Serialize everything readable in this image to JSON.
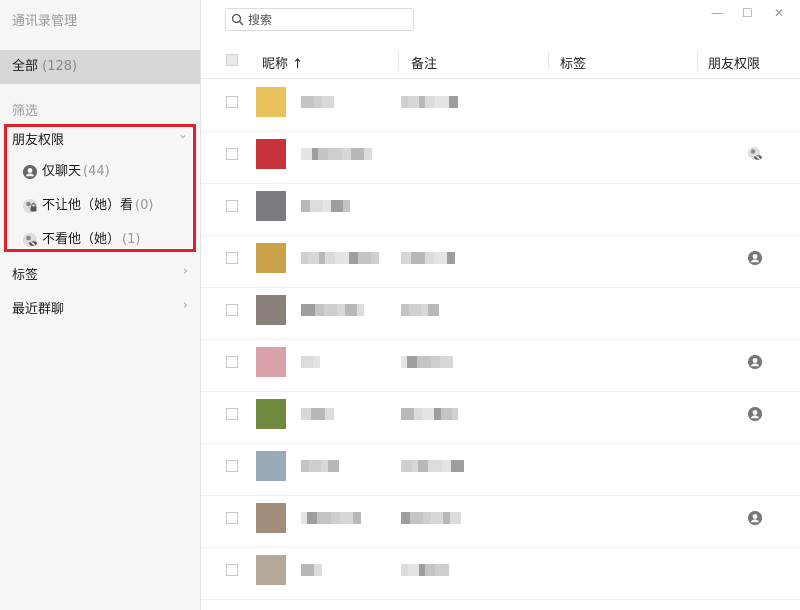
{
  "sidebar": {
    "title": "通讯录管理",
    "all_label": "全部",
    "all_count": "(128)",
    "filter_label": "筛选",
    "permission_label": "朋友权限",
    "permission_items": [
      {
        "label": "仅聊天",
        "count": "(44)",
        "icon": "person-icon"
      },
      {
        "label": "不让他（她）看",
        "count": "(0)",
        "icon": "lock-icon"
      },
      {
        "label": "不看他（她）",
        "count": "(1)",
        "icon": "eye-off-icon"
      }
    ],
    "tags_label": "标签",
    "recent_groups_label": "最近群聊"
  },
  "search": {
    "placeholder": "搜索"
  },
  "table": {
    "columns": {
      "nickname": "昵称 ↑",
      "remark": "备注",
      "tag": "标签",
      "permission": "朋友权限"
    },
    "rows": [
      {
        "avatar_color": "#e8c25a",
        "permission": ""
      },
      {
        "avatar_color": "#c7323a",
        "permission": "eye-off-icon"
      },
      {
        "avatar_color": "#7a7a80",
        "permission": ""
      },
      {
        "avatar_color": "#c9a24a",
        "permission": "person-icon"
      },
      {
        "avatar_color": "#8a8178",
        "permission": ""
      },
      {
        "avatar_color": "#d9a2a8",
        "permission": "person-icon"
      },
      {
        "avatar_color": "#6f8a3e",
        "permission": "person-icon"
      },
      {
        "avatar_color": "#9aaab8",
        "permission": ""
      },
      {
        "avatar_color": "#a28c7a",
        "permission": "person-icon"
      },
      {
        "avatar_color": "#b4a89a",
        "permission": ""
      }
    ]
  },
  "colors": {
    "highlight_border": "#e0212d",
    "sidebar_bg": "#f6f6f6",
    "selected_bg": "#d7d7d7"
  }
}
